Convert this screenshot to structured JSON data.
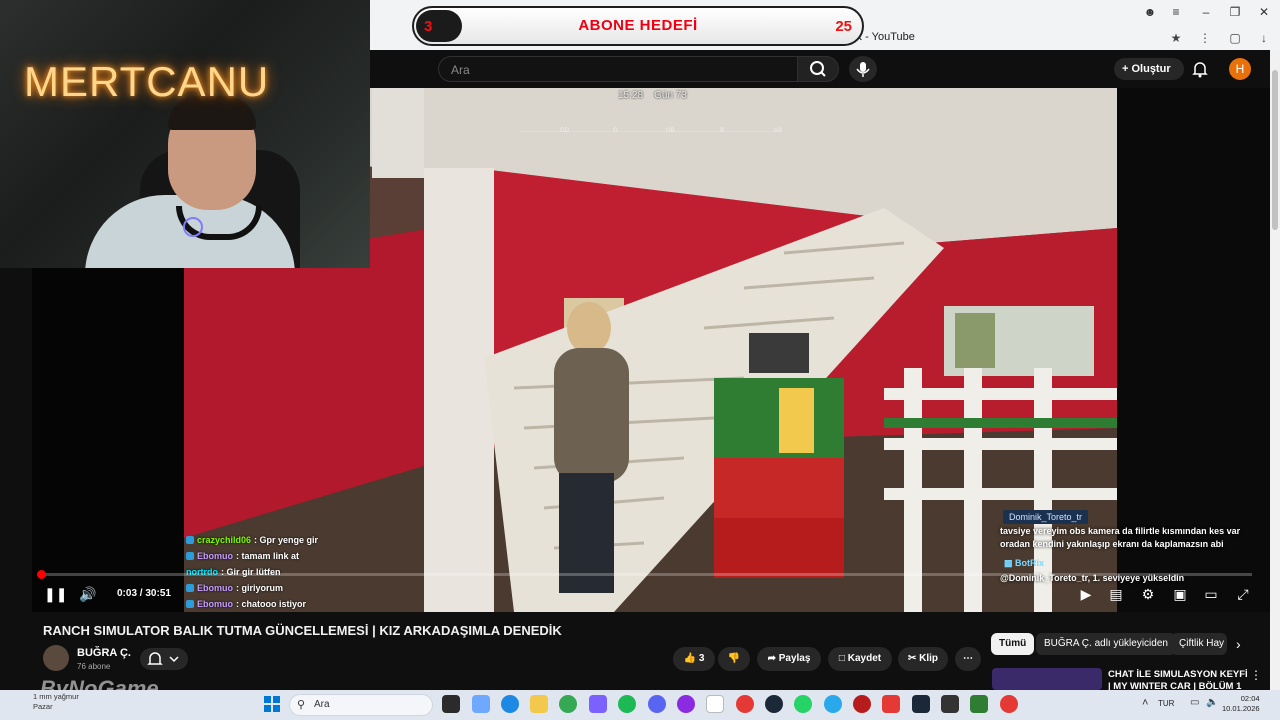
{
  "overlay": {
    "sub_goal": {
      "current": "3",
      "title": "ABONE HEDEFİ",
      "target": "25",
      "accent": "#ee1111"
    },
    "streamer_name": "MERTCANU",
    "watermark": "ByNoGame"
  },
  "browser": {
    "tab_title": "RANCH SIMULATOR BALIK TUTMA GÜNCELLEMESİ | KIZ ARKADAŞIMLA DENEDİK - YouTube"
  },
  "youtube": {
    "search_placeholder": "Ara",
    "create_label": "Oluştur",
    "avatar_letter": "H",
    "video": {
      "hud_time": "15:28",
      "hud_day": "Gün 73",
      "compass": [
        "GD",
        "G",
        "GB",
        "B",
        "KB"
      ],
      "time_current": "0:03",
      "time_total": "30:51",
      "progress": 0.002
    },
    "title": "RANCH SIMULATOR BALIK TUTMA GÜNCELLEMESİ | KIZ ARKADAŞIMLA DENEDİK",
    "channel": {
      "name": "BUĞRA Ç.",
      "subs": "76 abone"
    },
    "actions": {
      "likes": "3",
      "share": "Paylaş",
      "save": "Kaydet",
      "clip": "Klip"
    },
    "chips": [
      "Tümü",
      "BUĞRA Ç. adlı yükleyiciden",
      "Çiftlik Hay"
    ],
    "recommended_title": "CHAT İLE SIMULASYON KEYFİ | MY WINTER CAR | BÖLÜM 1"
  },
  "chat": [
    {
      "user": "crazychild06",
      "msg": ": Gpr yenge gir",
      "color": "#7CFC00"
    },
    {
      "user": "Ebomuo",
      "msg": ": tamam link at",
      "color": "#c49bff"
    },
    {
      "user": "nortrdo",
      "msg": ": Gir gir lütfen",
      "color": "#00e5ff"
    },
    {
      "user": "Ebomuo",
      "msg": ": giriyorum",
      "color": "#c49bff"
    },
    {
      "user": "Ebomuo",
      "msg": ": chatooo istiyor",
      "color": "#c49bff"
    }
  ],
  "popup": {
    "user": "Dominik_Toreto_tr",
    "text": "tavsiye vereyim obs kamera da filirtle kısmından kes var oradan kendini yakınlaşıp ekranı da kaplamazsın abi",
    "bot_name": "BotRix",
    "bot_text": "@Dominik_Toreto_tr, 1. seviyeye yükseldin"
  },
  "taskbar": {
    "search": "Ara",
    "weather_line1": "1 mm yağmur",
    "weather_line2": "Pazar",
    "lang": "TUR",
    "time": "02:04",
    "date": "10.01.2026"
  }
}
